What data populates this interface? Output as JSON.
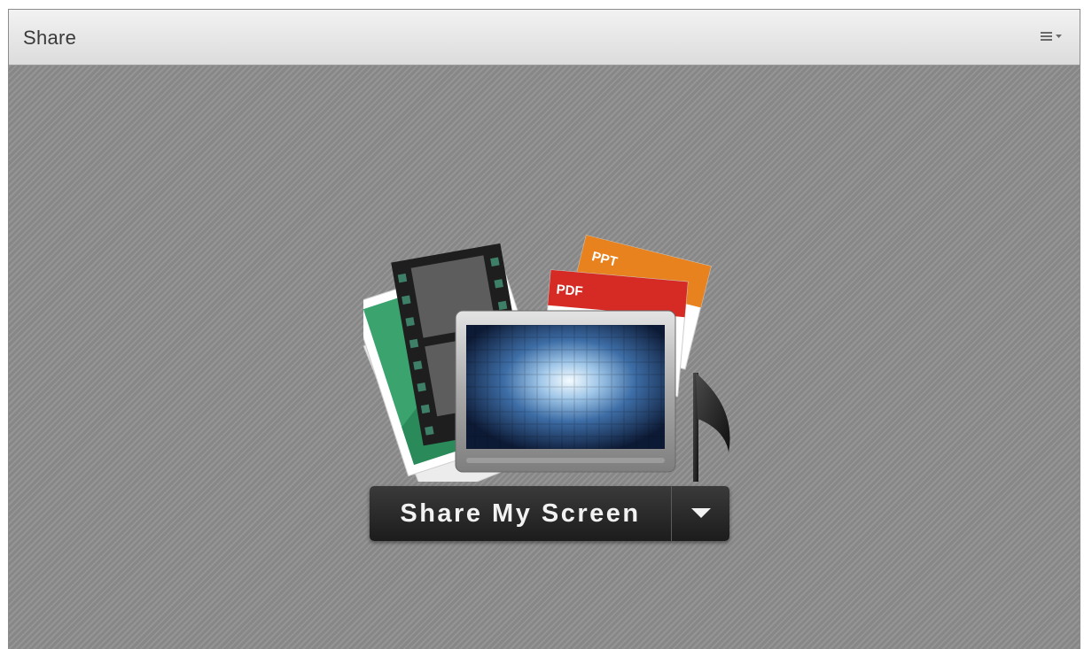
{
  "panel": {
    "title": "Share",
    "menu_icon": "options-menu-icon"
  },
  "hero": {
    "icon": "share-content-illustration",
    "doc_labels": {
      "ppt": "PPT",
      "pdf": "PDF"
    },
    "colors": {
      "ppt": "#e8821e",
      "pdf": "#d52b24",
      "photo_green": "#3aa36e",
      "screen_blue": "#5a8fc8"
    }
  },
  "share_button": {
    "label": "Share My Screen",
    "dropdown_icon": "triangle-down-icon"
  }
}
